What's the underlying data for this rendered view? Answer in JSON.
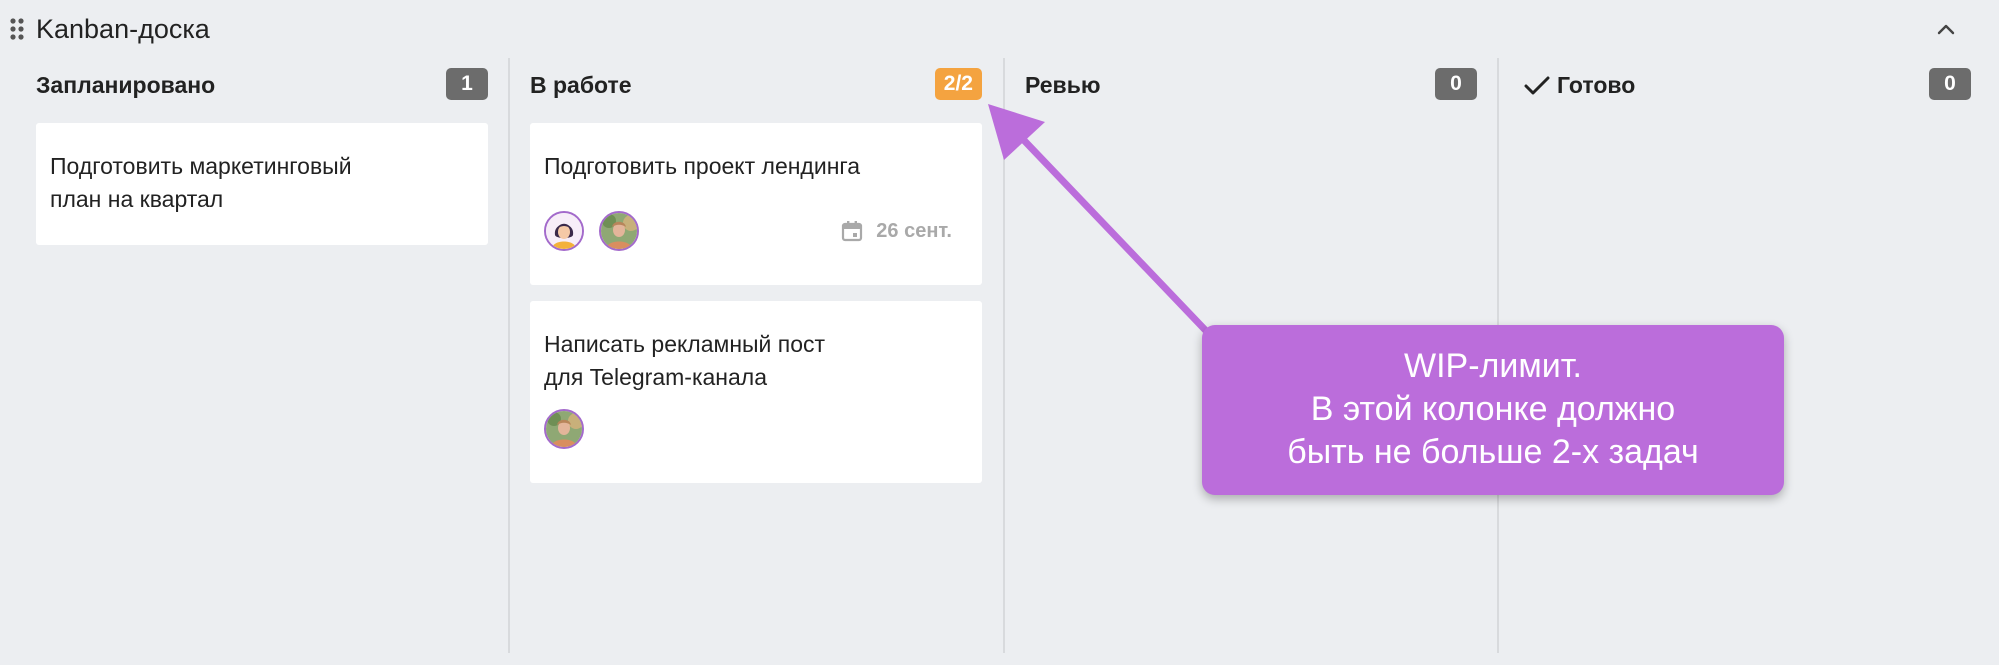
{
  "board": {
    "title": "Kanban-доска",
    "collapse_icon": "chevron-up-icon",
    "drag_icon": "drag-handle-icon"
  },
  "columns": [
    {
      "title": "Запланировано",
      "count": "1",
      "cards": [
        {
          "title": "Подготовить маркетинговый\nплан на квартал"
        }
      ]
    },
    {
      "title": "В работе",
      "count": "2/2",
      "count_color": "#f4a340",
      "cards": [
        {
          "title": "Подготовить проект лендинга",
          "due": "26 сент.",
          "due_icon": "calendar-icon"
        },
        {
          "title": "Написать рекламный пост\nдля Telegram-канала"
        }
      ]
    },
    {
      "title": "Ревью",
      "count": "0",
      "cards": []
    },
    {
      "title": "Готово",
      "title_icon": "check-icon",
      "count": "0",
      "cards": []
    }
  ],
  "callout": {
    "text": "WIP-лимит.\nВ этой колонке должно\nбыть не больше 2-х задач",
    "color": "#bb6ddb"
  },
  "colors": {
    "background": "#eceef1",
    "badge": "#6c6c6c",
    "wip_badge": "#f4a340",
    "avatar_border": "#a36acb"
  }
}
